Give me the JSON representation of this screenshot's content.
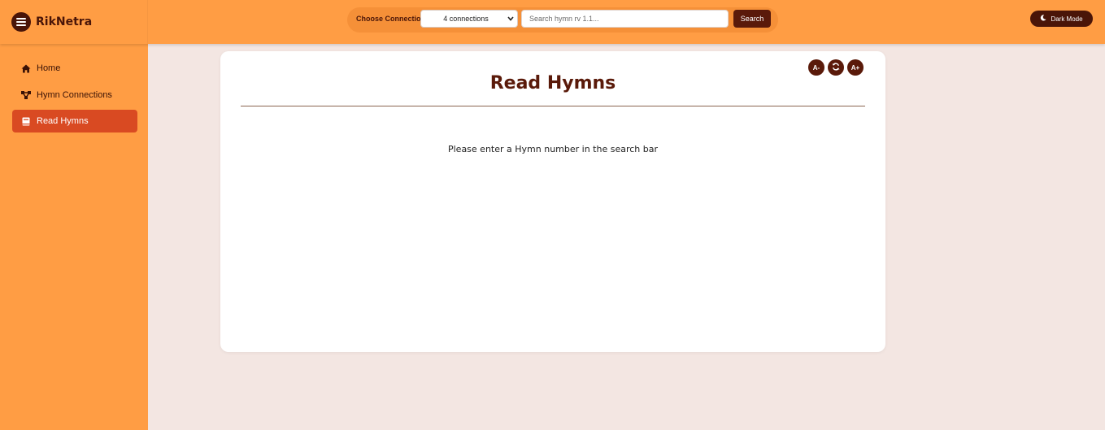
{
  "brand": {
    "name": "RikNetra",
    "menu_icon": "hamburger-menu-icon"
  },
  "toolbar": {
    "connection_label": "Choose Connection:",
    "connection_selected": "4 connections",
    "search_placeholder": "Search hymn rv 1.1...",
    "search_value": "",
    "search_button": "Search",
    "dark_mode_label": "Dark Mode"
  },
  "sidebar": {
    "items": [
      {
        "label": "Home",
        "icon": "home-icon",
        "active": false
      },
      {
        "label": "Hymn Connections",
        "icon": "network-icon",
        "active": false
      },
      {
        "label": "Read Hymns",
        "icon": "book-icon",
        "active": true
      }
    ]
  },
  "main": {
    "title": "Read Hymns",
    "message": "Please enter a Hymn number in the search bar",
    "tools": {
      "decrease_font": "A-",
      "increase_font": "A+"
    }
  },
  "colors": {
    "header_bg": "#ff9d44",
    "accent_dark": "#5a1a0a",
    "active_nav": "#d94a22",
    "page_bg": "#f3e6e2"
  }
}
